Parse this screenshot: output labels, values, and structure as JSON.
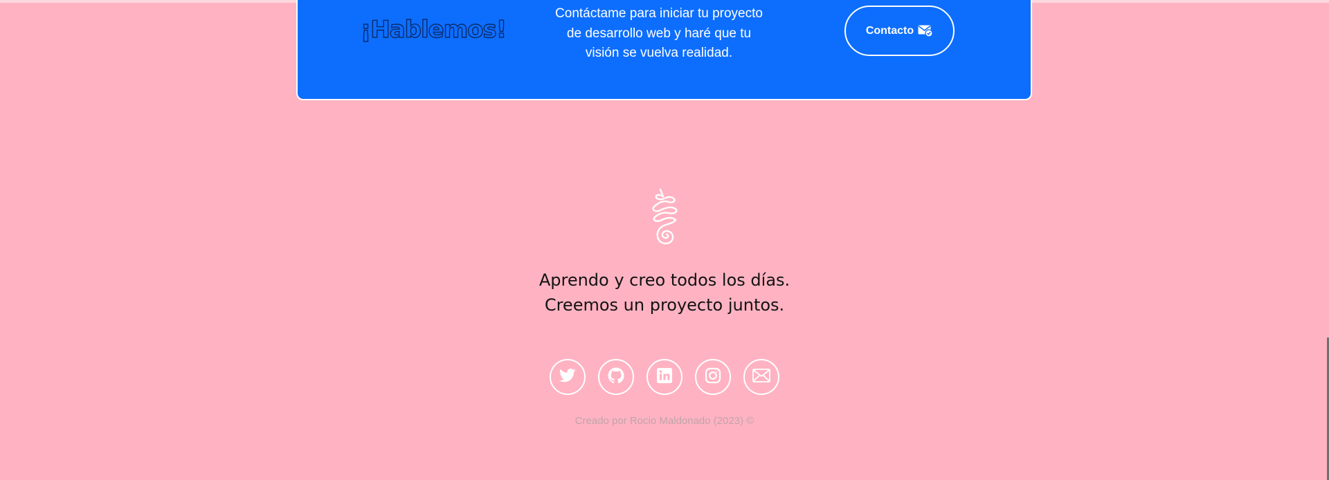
{
  "cta": {
    "heading": "¡Hablemos!",
    "text_lines": [
      "Contáctame para iniciar tu proyecto",
      "de desarrollo web y haré que tu",
      "visión se vuelva realidad."
    ],
    "button_label": "Contacto",
    "button_icon": "envelope-check-icon"
  },
  "footer": {
    "logo_icon": "swirl-logo-icon",
    "tagline_lines": [
      "Aprendo y creo todos los días.",
      "Creemos un proyecto juntos."
    ],
    "social_icons": [
      "twitter-icon",
      "github-icon",
      "linkedin-icon",
      "instagram-icon",
      "email-icon"
    ],
    "credit": "Creado por Rocio Maldonado (2023) ©"
  },
  "colors": {
    "page_background": "#ffb3c2",
    "card_blue": "#0d6efd",
    "text_white": "#ffffff",
    "credit_gray": "#c1a3a8"
  }
}
